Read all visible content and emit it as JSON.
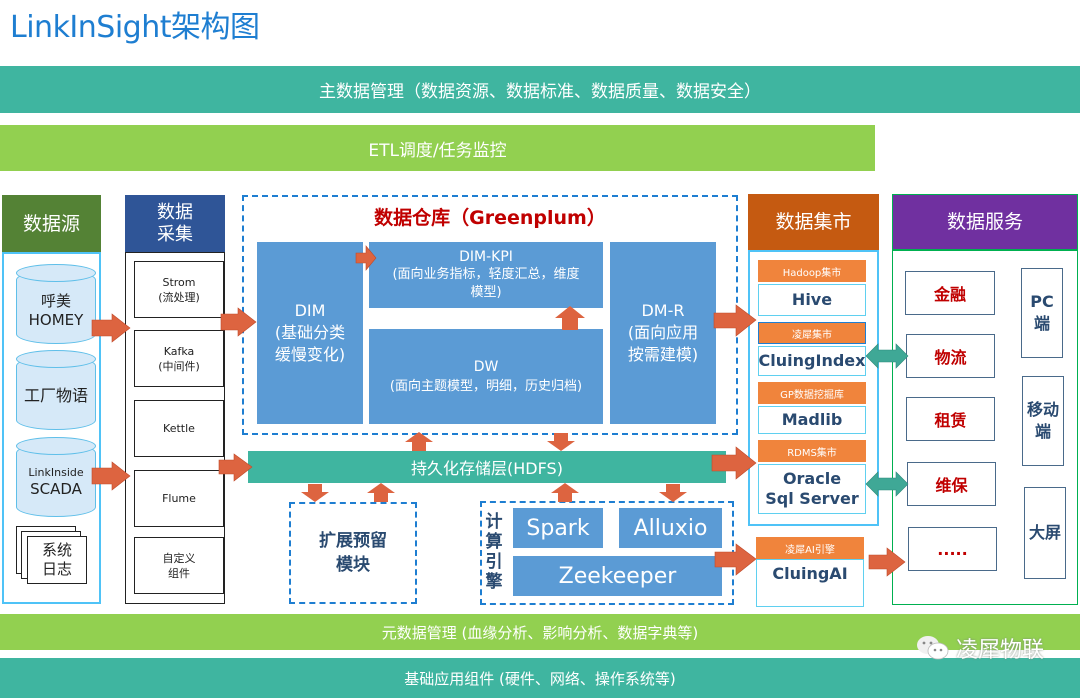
{
  "title": "LinkInSight架构图",
  "bars": {
    "master_data": "主数据管理（数据资源、数据标准、数据质量、数据安全）",
    "etl": "ETL调度/任务监控",
    "metadata": "元数据管理 (血缘分析、影响分析、数据字典等)",
    "infrastructure": "基础应用组件 (硬件、网络、操作系统等)"
  },
  "data_source": {
    "header": "数据源",
    "items": [
      {
        "line1": "呼美",
        "line2": "HOMEY"
      },
      {
        "line1": "工厂物语",
        "line2": ""
      },
      {
        "line1": "LinkInside",
        "line2": "SCADA"
      }
    ],
    "logs": {
      "line1": "系统",
      "line2": "日志"
    }
  },
  "collection": {
    "header_line1": "数据",
    "header_line2": "采集",
    "items": [
      {
        "line1": "Strom",
        "line2": "(流处理)"
      },
      {
        "line1": "Kafka",
        "line2": "(中间件)"
      },
      {
        "line1": "Kettle",
        "line2": ""
      },
      {
        "line1": "Flume",
        "line2": ""
      },
      {
        "line1": "自定义",
        "line2": "组件"
      }
    ]
  },
  "warehouse": {
    "title": "数据仓库（Greenplum）",
    "dim": {
      "name": "DIM",
      "desc1": "(基础分类",
      "desc2": "缓慢变化)"
    },
    "dim_kpi": {
      "name": "DIM-KPI",
      "desc1": "(面向业务指标，轻度汇总，维度",
      "desc2": "模型)"
    },
    "dw": {
      "name": "DW",
      "desc1": "(面向主题模型，明细，历史归档)"
    },
    "dm_r": {
      "name": "DM-R",
      "desc1": "(面向应用",
      "desc2": "按需建模)"
    }
  },
  "storage": {
    "label": "持久化存储层(HDFS)"
  },
  "extension": {
    "line1": "扩展预留",
    "line2": "模块"
  },
  "compute": {
    "label_chars": [
      "计",
      "算",
      "引",
      "擎"
    ],
    "spark": "Spark",
    "alluxio": "Alluxio",
    "zookeeper": "Zeekeeper"
  },
  "data_mart": {
    "header": "数据集市",
    "items": [
      {
        "tag": "Hadoop集市",
        "value1": "Hive",
        "value2": ""
      },
      {
        "tag": "凌犀集市",
        "value1": "CluingIndex",
        "value2": ""
      },
      {
        "tag": "GP数据挖掘库",
        "value1": "Madlib",
        "value2": ""
      },
      {
        "tag": "RDMS集市",
        "value1": "Oracle",
        "value2": "Sql Server"
      }
    ],
    "ai": {
      "tag": "凌犀AI引擎",
      "value": "CluingAI"
    }
  },
  "data_service": {
    "header": "数据服务",
    "domains": [
      "金融",
      "物流",
      "租赁",
      "维保",
      "....."
    ],
    "devices": [
      {
        "line1": "PC",
        "line2": "端"
      },
      {
        "line1": "移动",
        "line2": "端"
      },
      {
        "line1": "大屏",
        "line2": ""
      }
    ]
  },
  "watermark": "凌犀物联",
  "colors": {
    "title_blue": "#1e7ed1",
    "teal": "#3fb5a0",
    "lime": "#92d050",
    "source_header": "#548235",
    "collect_header": "#2f5597",
    "mart_header": "#c55a11",
    "service_header": "#7030a0",
    "arrow_orange": "#dd6440",
    "arrow_teal": "#3fa896",
    "box_blue": "#5b9bd5",
    "warehouse_title": "#c00000"
  }
}
